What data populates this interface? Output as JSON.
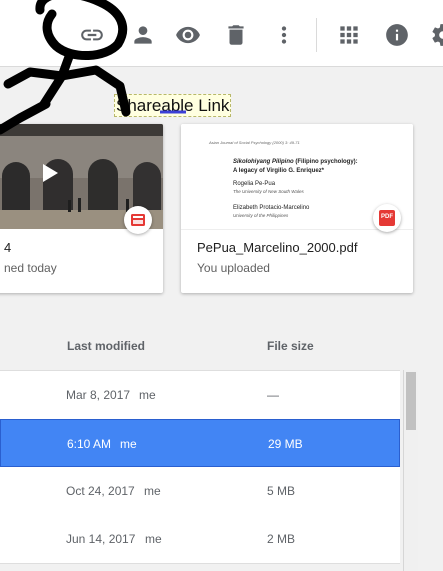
{
  "toolbar": {
    "icons": [
      "link-icon",
      "person-icon",
      "eye-icon",
      "trash-icon",
      "more-vert-icon",
      "grid-icon",
      "info-icon",
      "gear-icon"
    ]
  },
  "tooltip": {
    "text": "Shareable Link"
  },
  "cards": [
    {
      "title": "4",
      "subtitle": "ned today",
      "type_icon": "video-icon"
    },
    {
      "title": "PePua_Marcelino_2000.pdf",
      "subtitle": "You uploaded",
      "type_icon": "pdf-icon",
      "badge_label": "PDF",
      "preview": {
        "journal": "Asian Journal of Social Psychology (2000) 3: 49-71",
        "heading_italic": "Sikolohiyang Pilipino",
        "heading_rest": " (Filipino psychology):",
        "heading_line2": "A legacy of Virgilio G. Enriquez*",
        "author1": "Rogelia Pe-Pua",
        "affil1": "The University of New South Wales",
        "author2": "Elizabeth Protacio-Marcelino",
        "affil2": "University of the Philippines"
      }
    }
  ],
  "columns": {
    "modified": "Last modified",
    "size": "File size"
  },
  "rows": [
    {
      "modified": "Mar 8, 2017",
      "owner": "me",
      "size": "—",
      "selected": false
    },
    {
      "modified": "6:10 AM",
      "owner": "me",
      "size": "29 MB",
      "selected": true
    },
    {
      "modified": "Oct 24, 2017",
      "owner": "me",
      "size": "5 MB",
      "selected": false
    },
    {
      "modified": "Jun 14, 2017",
      "owner": "me",
      "size": "2 MB",
      "selected": false
    }
  ],
  "colors": {
    "selected_row": "#4285f4",
    "pdf_red": "#e53935",
    "icon_gray": "#5f6368"
  }
}
